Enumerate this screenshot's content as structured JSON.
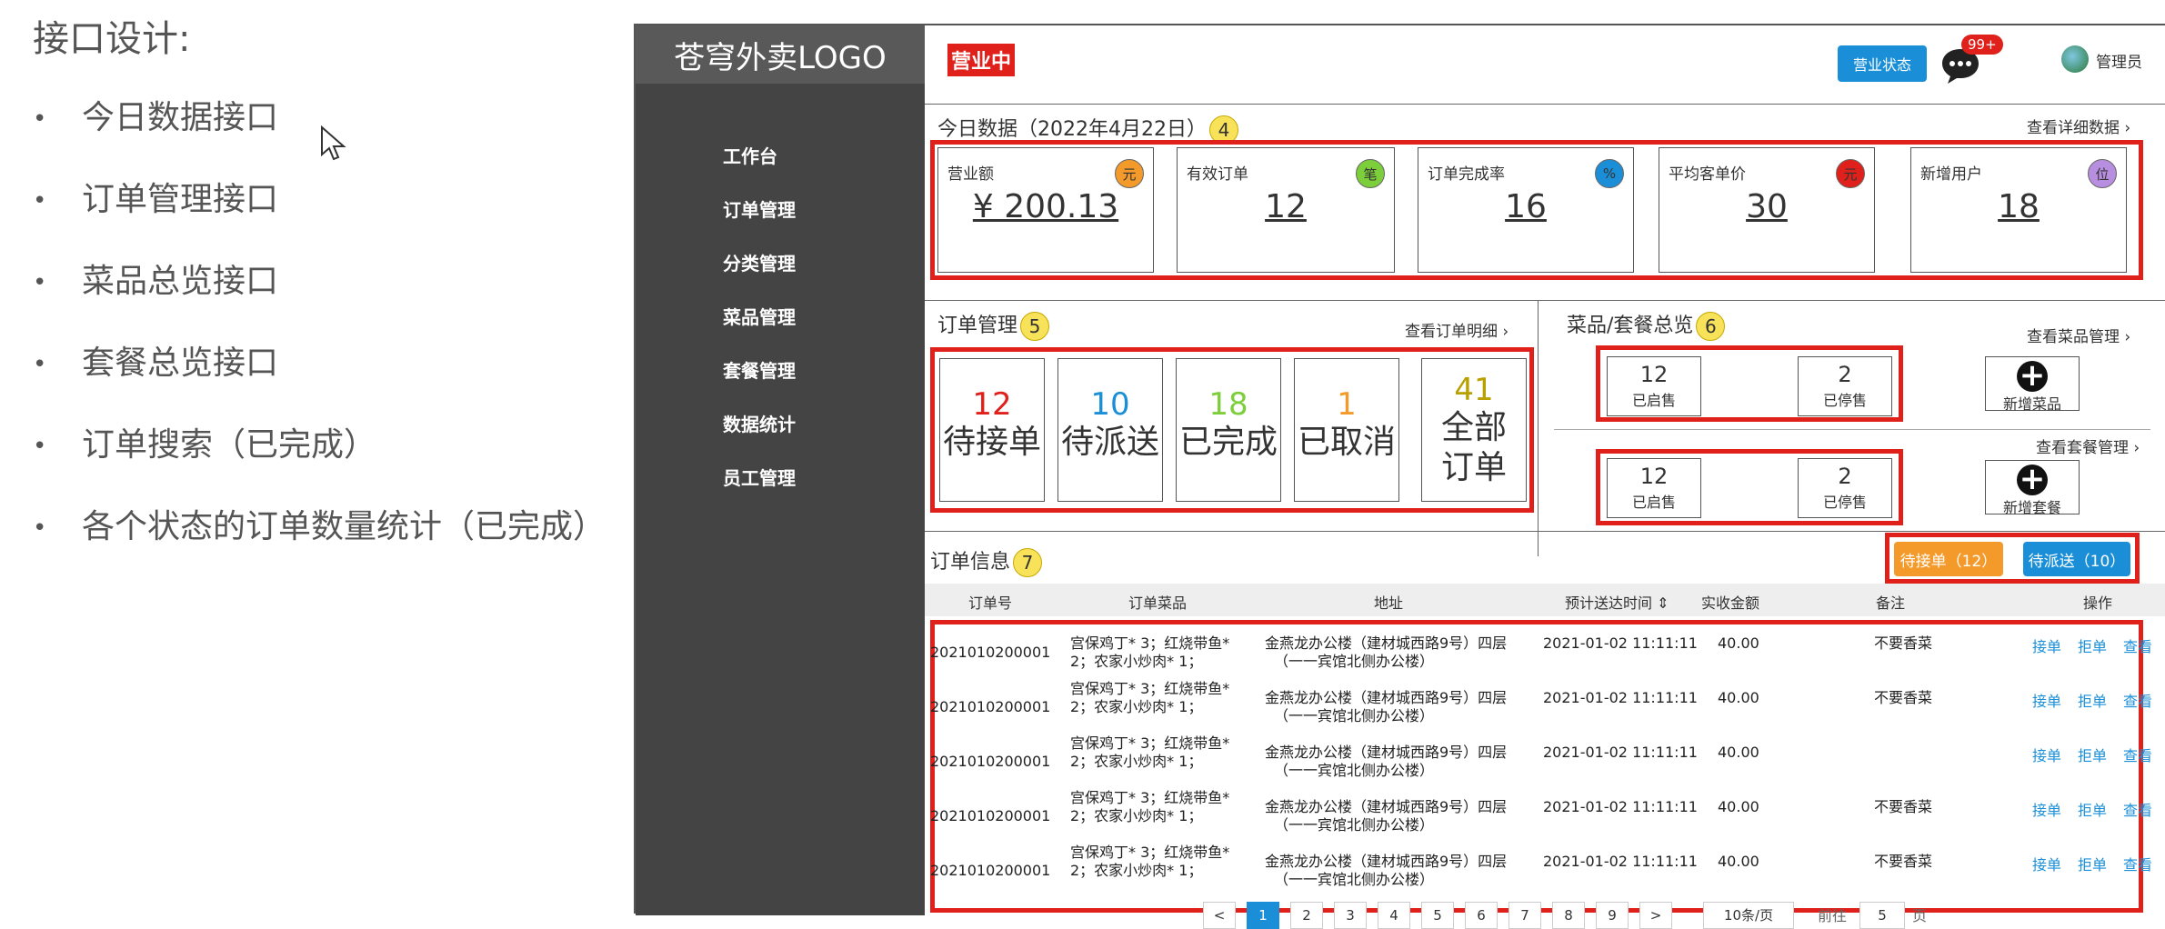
{
  "slide": {
    "title": "接口设计:",
    "bullets": [
      "今日数据接口",
      "订单管理接口",
      "菜品总览接口",
      "套餐总览接口",
      "订单搜索（已完成）",
      "各个状态的订单数量统计（已完成）"
    ],
    "bullet_symbol": "•"
  },
  "app": {
    "logo": "苍穹外卖LOGO",
    "menu": [
      "工作台",
      "订单管理",
      "分类管理",
      "菜品管理",
      "套餐管理",
      "数据统计",
      "员工管理"
    ],
    "header": {
      "status_tag": "营业中",
      "status_button": "营业状态",
      "message_badge": "99+",
      "admin": "管理员"
    },
    "today": {
      "title": "今日数据（2022年4月22日）",
      "marker": "4",
      "more": "查看详细数据",
      "cards": [
        {
          "label": "营业额",
          "icon": "元",
          "icon_color": "#f39a2a",
          "value": "¥ 200.13"
        },
        {
          "label": "有效订单",
          "icon": "笔",
          "icon_color": "#7ccf3a",
          "value": "12"
        },
        {
          "label": "订单完成率",
          "icon": "%",
          "icon_color": "#1a8fd8",
          "value": "16"
        },
        {
          "label": "平均客单价",
          "icon": "元",
          "icon_color": "#e0201a",
          "value": "30"
        },
        {
          "label": "新增用户",
          "icon": "位",
          "icon_color": "#b78ee0",
          "value": "18"
        }
      ]
    },
    "orders": {
      "title": "订单管理",
      "marker": "5",
      "more": "查看订单明细",
      "cards": [
        {
          "count": "12",
          "label": "待接单",
          "color": "#e0201a"
        },
        {
          "count": "10",
          "label": "待派送",
          "color": "#1a8fd8"
        },
        {
          "count": "18",
          "label": "已完成",
          "color": "#7ccf3a"
        },
        {
          "count": "1",
          "label": "已取消",
          "color": "#f39a2a"
        },
        {
          "count": "41",
          "label": "全部订单",
          "color": "#b8a000"
        }
      ]
    },
    "dishes": {
      "title": "菜品/套餐总览",
      "marker": "6",
      "more_dish": "查看菜品管理",
      "more_setmeal": "查看套餐管理",
      "dish_on": {
        "num": "12",
        "label": "已启售"
      },
      "dish_off": {
        "num": "2",
        "label": "已停售"
      },
      "set_on": {
        "num": "12",
        "label": "已启售"
      },
      "set_off": {
        "num": "2",
        "label": "已停售"
      },
      "add_dish": "新增菜品",
      "add_setmeal": "新增套餐"
    },
    "order_info": {
      "title": "订单信息",
      "marker": "7",
      "btn_pending": "待接单（12）",
      "btn_dispatch": "待派送（10）",
      "columns": [
        "订单号",
        "订单菜品",
        "地址",
        "预计送达时间",
        "实收金额",
        "备注",
        "操作"
      ],
      "rows": [
        {
          "id": "2021010200001",
          "dish1": "宫保鸡丁* 3；红烧带鱼*",
          "dish2": "2；农家小炒肉* 1；",
          "addr1": "金燕龙办公楼（建材城西路9号）四层",
          "addr2": "（一一宾馆北侧办公楼）",
          "time": "2021-01-02 11:11:11",
          "amount": "40.00",
          "remark": "不要香菜"
        },
        {
          "id": "2021010200001",
          "dish1": "宫保鸡丁* 3；红烧带鱼*",
          "dish2": "2；农家小炒肉* 1；",
          "addr1": "金燕龙办公楼（建材城西路9号）四层",
          "addr2": "（一一宾馆北侧办公楼）",
          "time": "2021-01-02 11:11:11",
          "amount": "40.00",
          "remark": "不要香菜"
        },
        {
          "id": "2021010200001",
          "dish1": "宫保鸡丁* 3；红烧带鱼*",
          "dish2": "2；农家小炒肉* 1；",
          "addr1": "金燕龙办公楼（建材城西路9号）四层",
          "addr2": "（一一宾馆北侧办公楼）",
          "time": "2021-01-02 11:11:11",
          "amount": "40.00",
          "remark": ""
        },
        {
          "id": "2021010200001",
          "dish1": "宫保鸡丁* 3；红烧带鱼*",
          "dish2": "2；农家小炒肉* 1；",
          "addr1": "金燕龙办公楼（建材城西路9号）四层",
          "addr2": "（一一宾馆北侧办公楼）",
          "time": "2021-01-02 11:11:11",
          "amount": "40.00",
          "remark": "不要香菜"
        },
        {
          "id": "2021010200001",
          "dish1": "宫保鸡丁* 3；红烧带鱼*",
          "dish2": "2；农家小炒肉* 1；",
          "addr1": "金燕龙办公楼（建材城西路9号）四层",
          "addr2": "（一一宾馆北侧办公楼）",
          "time": "2021-01-02 11:11:11",
          "amount": "40.00",
          "remark": "不要香菜"
        }
      ],
      "ops": [
        "接单",
        "拒单",
        "查看"
      ],
      "pages": [
        "<",
        "1",
        "2",
        "3",
        "4",
        "5",
        "6",
        "7",
        "8",
        "9",
        ">"
      ],
      "page_size": "10条/页",
      "goto": "前往",
      "goto_value": "5",
      "page_unit": "页"
    }
  }
}
